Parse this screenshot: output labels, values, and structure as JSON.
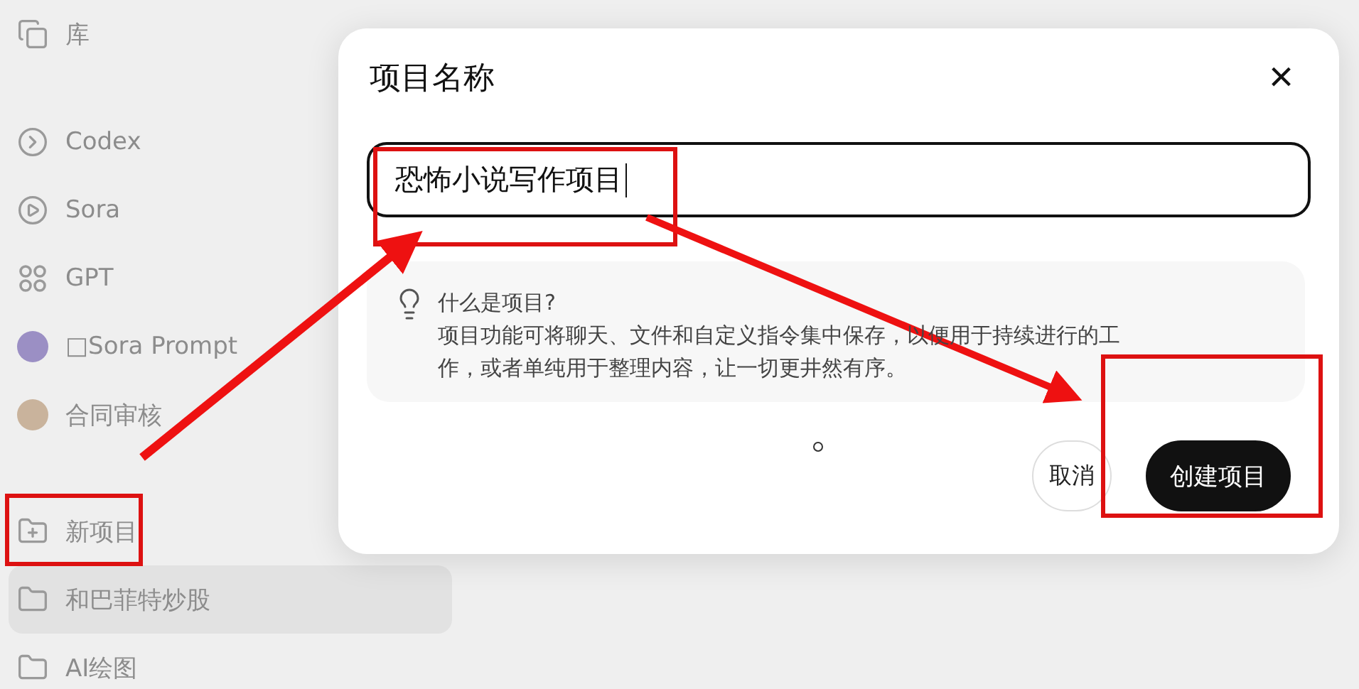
{
  "sidebar": {
    "groups": [
      {
        "items": [
          {
            "kind": "library",
            "label": "库",
            "selected": false
          }
        ]
      },
      {
        "items": [
          {
            "kind": "terminal",
            "label": "Codex",
            "selected": false
          },
          {
            "kind": "play",
            "label": "Sora",
            "selected": false
          },
          {
            "kind": "grid",
            "label": "GPT",
            "selected": false
          },
          {
            "kind": "avatar",
            "label": "□Sora Prompt",
            "selected": false
          },
          {
            "kind": "photo",
            "label": "合同审核",
            "selected": false
          }
        ]
      },
      {
        "items": [
          {
            "kind": "new",
            "label": "新项目",
            "selected": false
          },
          {
            "kind": "folder",
            "label": "和巴菲特炒股",
            "selected": true
          },
          {
            "kind": "folder",
            "label": "AI绘图",
            "selected": false
          }
        ]
      }
    ]
  },
  "dialog": {
    "title": "项目名称",
    "close": "×",
    "input": {
      "value": "恐怖小说写作项目"
    },
    "info": {
      "title": "什么是项目?",
      "body": "项目功能可将聊天、文件和自定义指令集中保存，以便用于持续进行的工作，或者单纯用于整理内容，让一切更井然有序。"
    },
    "buttons": [
      {
        "kind": "secondary",
        "label": "取消"
      },
      {
        "kind": "primary",
        "label": "创建项目"
      }
    ]
  }
}
